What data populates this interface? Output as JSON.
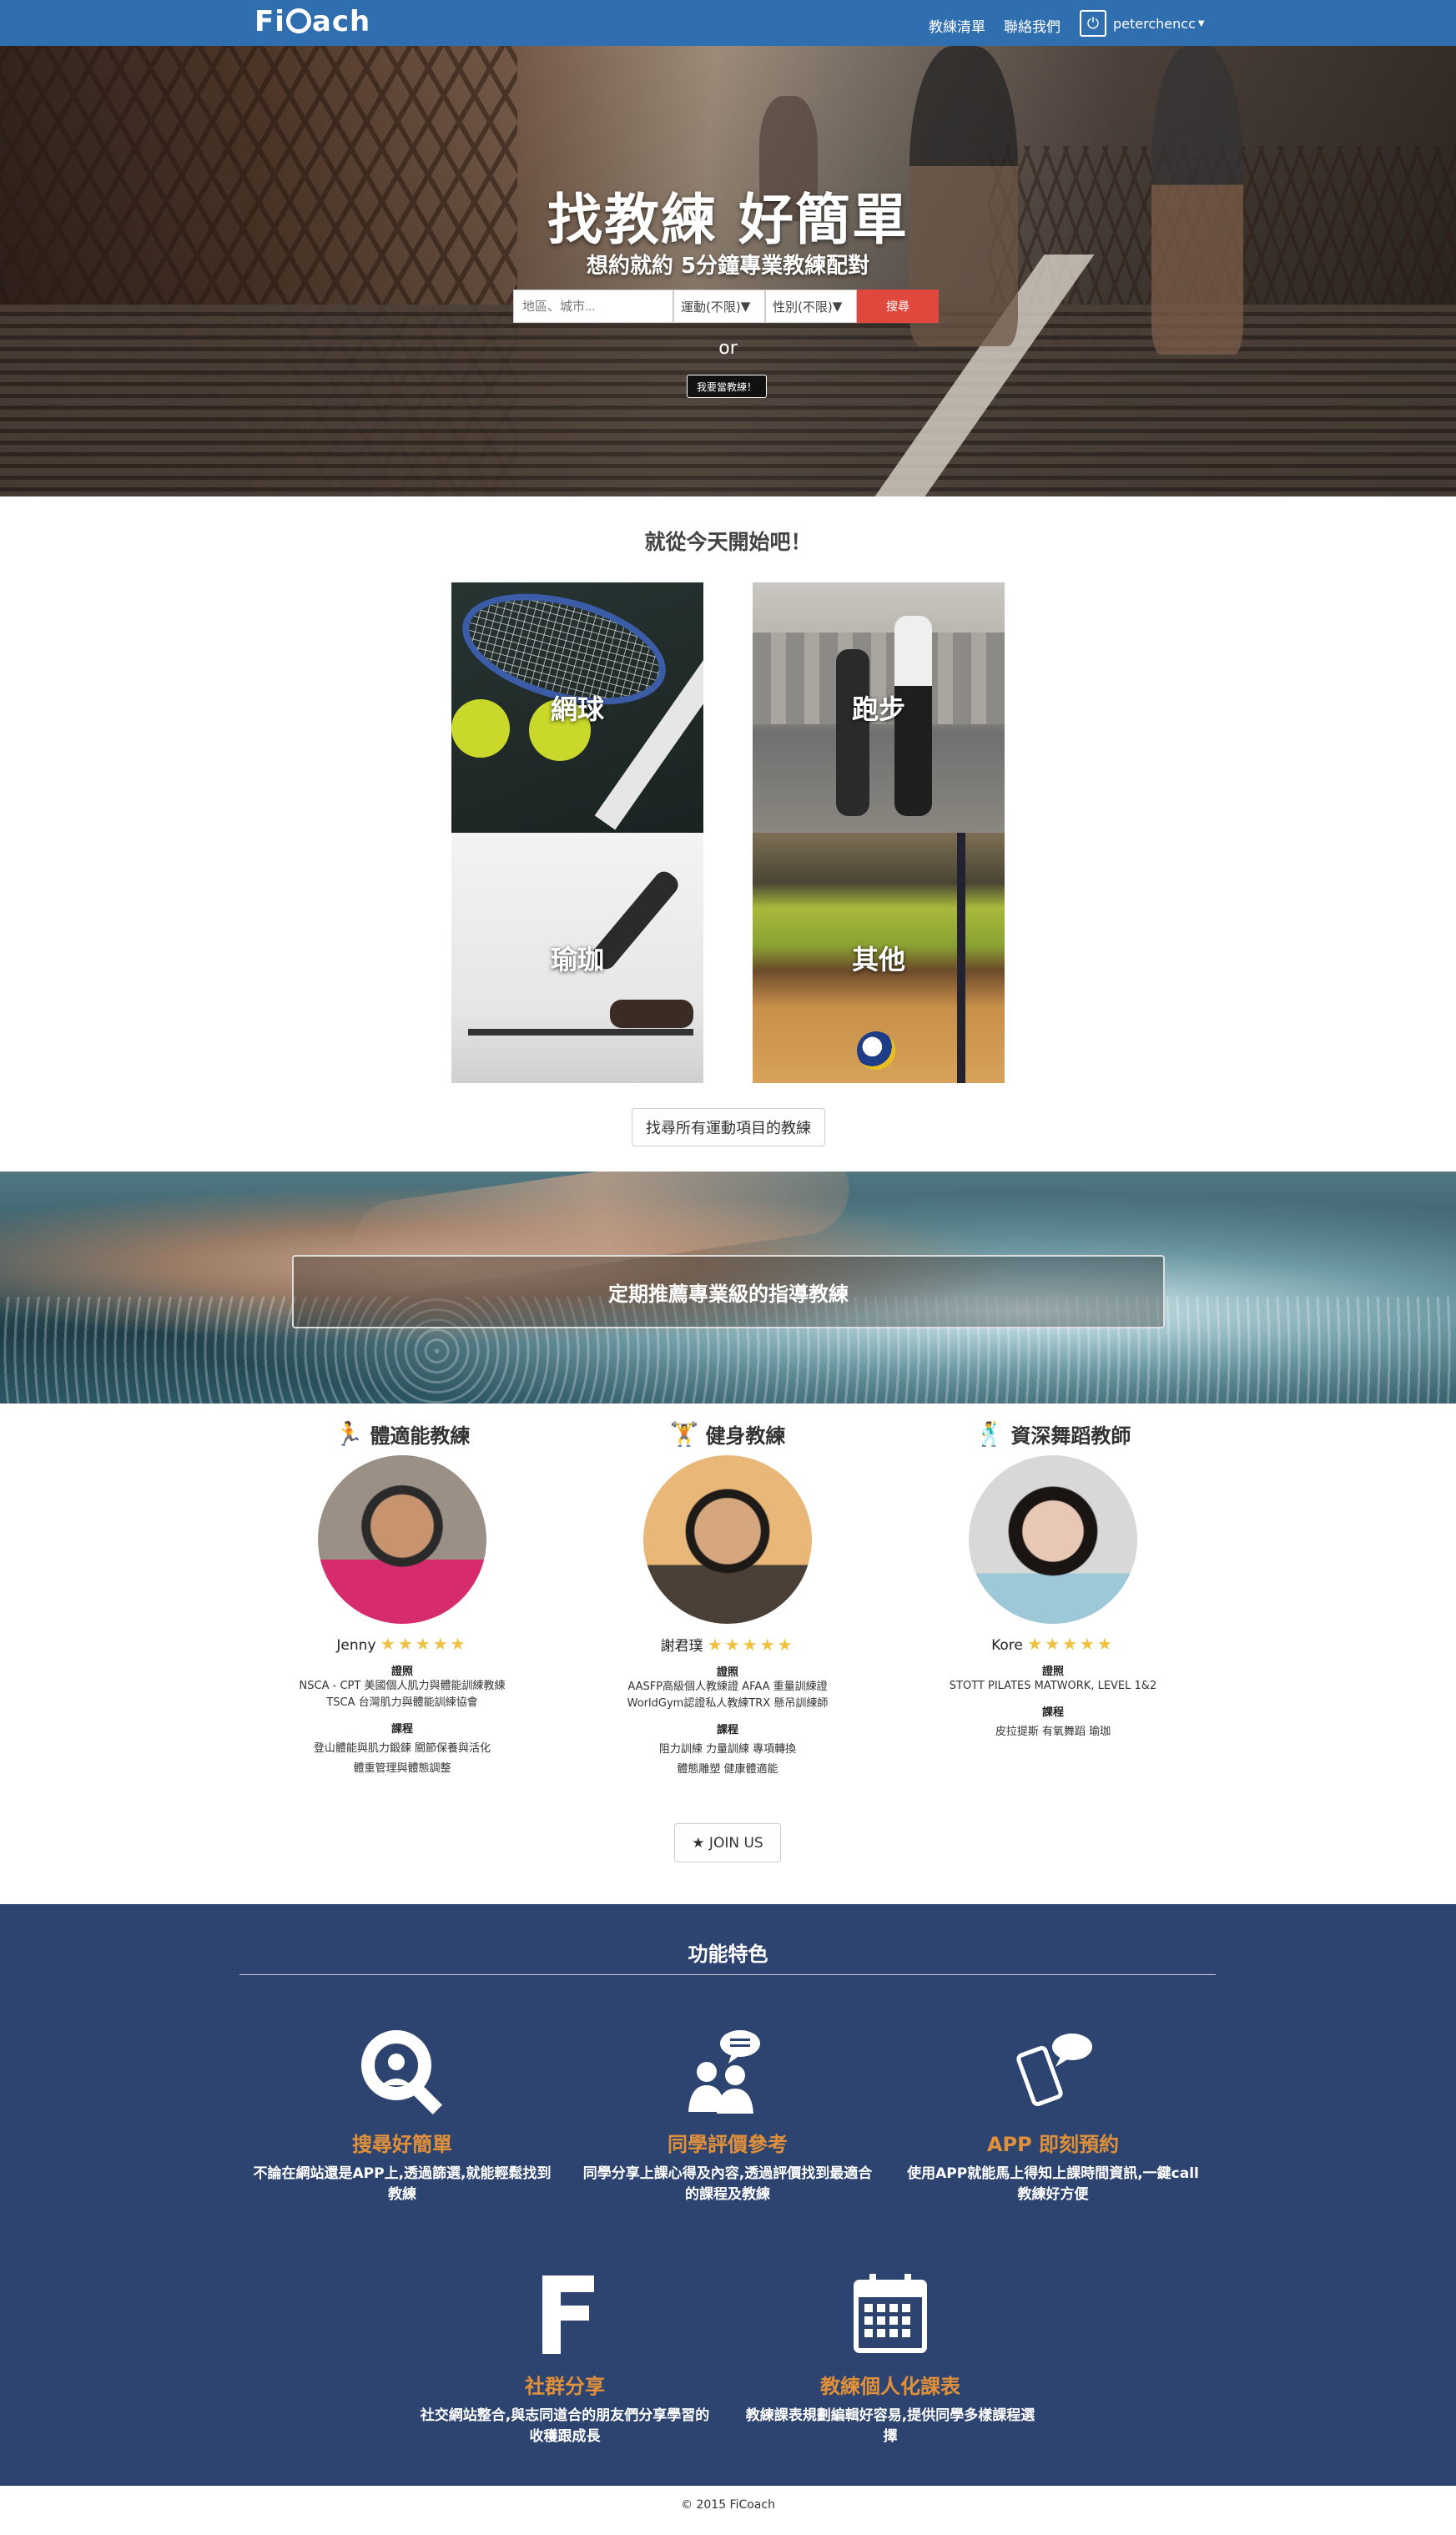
{
  "nav": {
    "logo": "FiCoach",
    "logo_pre": "Fi",
    "logo_post": "ach",
    "links": [
      "教練清單",
      "聯絡我們"
    ],
    "user": "peterchencc"
  },
  "hero": {
    "title": "找教練 好簡單",
    "subtitle": "想約就約 5分鐘專業教練配對",
    "search_placeholder": "地區、城市...",
    "sport_select": "運動(不限)",
    "gender_select": "性別(不限)",
    "search_button": "搜尋",
    "or": "or",
    "coach_button": "我要當教練！"
  },
  "start": {
    "title": "就從今天開始吧！",
    "tiles": [
      "網球",
      "跑步",
      "瑜珈",
      "其他"
    ],
    "all_button": "找尋所有運動項目的教練"
  },
  "banner": {
    "text": "定期推薦專業級的指導教練"
  },
  "coaches": [
    {
      "category": "體適能教練",
      "icon": "runner-icon",
      "name": "Jenny",
      "rating": 5,
      "cert_label": "證照",
      "certs": [
        "NSCA - CPT 美國個人肌力與體能訓練教練",
        "TSCA 台灣肌力與體能訓練協會"
      ],
      "course_label": "課程",
      "courses": [
        "登山體能與肌力鍛鍊 關節保養與活化",
        "體重管理與體態調整"
      ]
    },
    {
      "category": "健身教練",
      "icon": "weightlifter-icon",
      "name": "謝君璞",
      "rating": 5,
      "cert_label": "證照",
      "certs": [
        "AASFP高級個人教練證 AFAA 重量訓練證",
        "WorldGym認證私人教練TRX 懸吊訓練師"
      ],
      "course_label": "課程",
      "courses": [
        "阻力訓練 力量訓練 專項轉換",
        "體態雕塑 健康體適能"
      ]
    },
    {
      "category": "資深舞蹈教師",
      "icon": "dancer-icon",
      "name": "Kore",
      "rating": 5,
      "cert_label": "證照",
      "certs": [
        "STOTT PILATES MATWORK, LEVEL 1&2"
      ],
      "course_label": "課程",
      "courses": [
        "皮拉提斯 有氧舞蹈 瑜珈"
      ]
    }
  ],
  "join": "★ JOIN US",
  "features": {
    "title": "功能特色",
    "items": [
      {
        "icon": "search-pin-icon",
        "title": "搜尋好簡單",
        "desc": "不論在網站還是APP上,透過篩選,就能輕鬆找到教練"
      },
      {
        "icon": "community-chat-icon",
        "title": "同學評價參考",
        "desc": "同學分享上課心得及內容,透過評價找到最適合的課程及教練"
      },
      {
        "icon": "phone-chat-icon",
        "title": "APP 即刻預約",
        "desc": "使用APP就能馬上得知上課時間資訊,一鍵call教練好方便"
      },
      {
        "icon": "facebook-icon",
        "title": "社群分享",
        "desc": "社交網站整合,與志同道合的朋友們分享學習的收穫跟成長"
      },
      {
        "icon": "calendar-icon",
        "title": "教練個人化課表",
        "desc": "教練課表規劃編輯好容易,提供同學多樣課程選擇"
      }
    ]
  },
  "footer": "© 2015 FiCoach",
  "colors": {
    "nav": "#2f6fb0",
    "accent": "#e0473d",
    "features_bg": "#2e4470",
    "feature_title": "#e0903a",
    "star": "#f0c040"
  }
}
